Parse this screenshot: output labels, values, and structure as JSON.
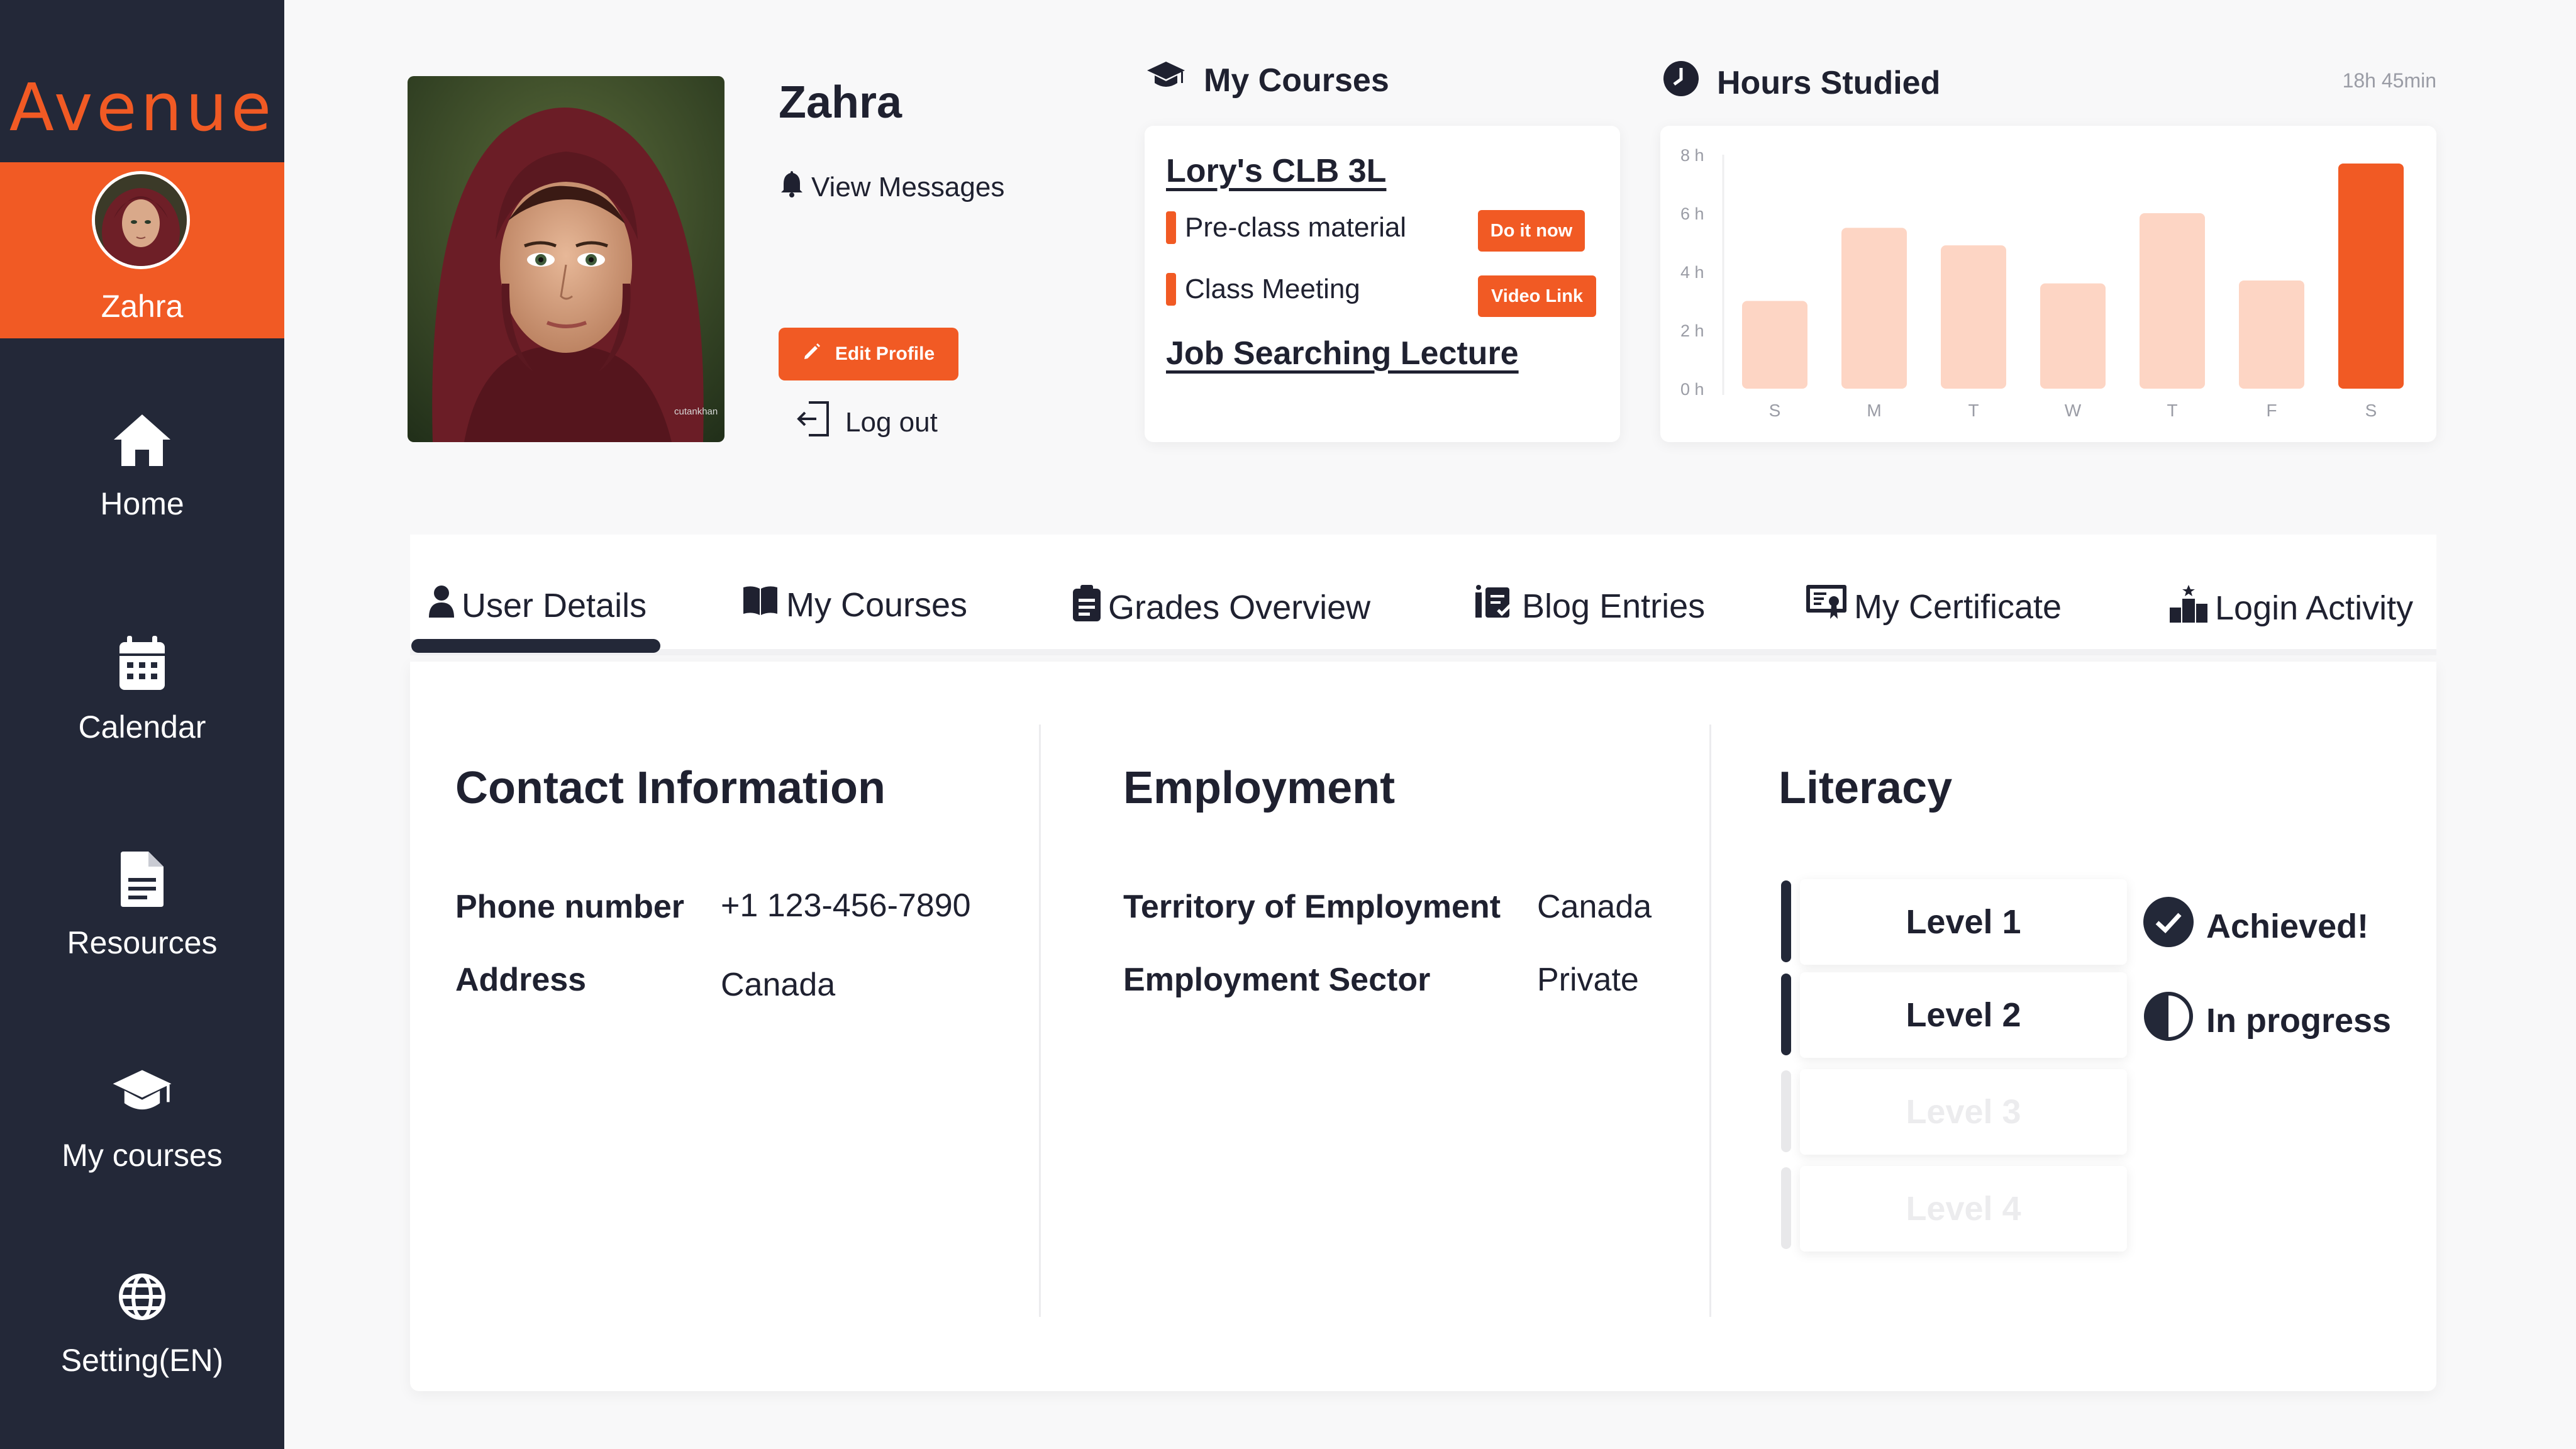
{
  "brand": {
    "logo_text": "Avenue",
    "accent": "#f15a24",
    "sidebar_bg": "#232838"
  },
  "sidebar": {
    "user_name": "Zahra",
    "items": [
      {
        "label": "Home",
        "icon": "home-icon"
      },
      {
        "label": "Calendar",
        "icon": "calendar-icon"
      },
      {
        "label": "Resources",
        "icon": "document-icon"
      },
      {
        "label": "My courses",
        "icon": "graduation-cap-icon"
      },
      {
        "label": "Setting(EN)",
        "icon": "globe-icon"
      }
    ]
  },
  "profile": {
    "name": "Zahra",
    "view_messages": "View Messages",
    "edit_profile": "Edit Profile",
    "logout": "Log out",
    "photo_watermark": "cutankhan"
  },
  "my_courses_card": {
    "title": "My Courses",
    "course_1": "Lory's CLB 3L",
    "item_1": {
      "label": "Pre-class material",
      "action": "Do it now"
    },
    "item_2": {
      "label": "Class Meeting",
      "action": "Video Link"
    },
    "course_2": "Job Searching Lecture"
  },
  "hours_card": {
    "title": "Hours Studied",
    "total": "18h 45min"
  },
  "chart_data": {
    "type": "bar",
    "categories": [
      "S",
      "M",
      "T",
      "W",
      "T",
      "F",
      "S"
    ],
    "values": [
      3.0,
      5.5,
      4.9,
      3.6,
      6.0,
      3.7,
      7.7
    ],
    "highlight_index": 6,
    "yticks": [
      "0 h",
      "2 h",
      "4 h",
      "6 h",
      "8 h"
    ],
    "ylim": [
      0,
      8
    ],
    "colors": {
      "bar": "#fdd5c4",
      "highlight": "#f15a24"
    },
    "title": "",
    "xlabel": "",
    "ylabel": ""
  },
  "tabs": [
    {
      "label": "User Details",
      "icon": "user-icon",
      "active": true
    },
    {
      "label": "My Courses",
      "icon": "book-icon"
    },
    {
      "label": "Grades Overview",
      "icon": "clipboard-icon"
    },
    {
      "label": "Blog Entries",
      "icon": "blog-icon"
    },
    {
      "label": "My Certificate",
      "icon": "certificate-icon"
    },
    {
      "label": "Login Activity",
      "icon": "podium-icon"
    }
  ],
  "contact": {
    "title": "Contact Information",
    "phone_label": "Phone number",
    "phone_value": "+1 123-456-7890",
    "address_label": "Address",
    "address_value": "Canada"
  },
  "employment": {
    "title": "Employment",
    "territory_label": "Territory of Employment",
    "territory_value": "Canada",
    "sector_label": "Employment Sector",
    "sector_value": "Private"
  },
  "literacy": {
    "title": "Literacy",
    "levels": [
      {
        "label": "Level 1",
        "status": "Achieved!",
        "enabled": true
      },
      {
        "label": "Level 2",
        "status": "In progress",
        "enabled": true
      },
      {
        "label": "Level 3",
        "enabled": false
      },
      {
        "label": "Level 4",
        "enabled": false
      }
    ]
  }
}
